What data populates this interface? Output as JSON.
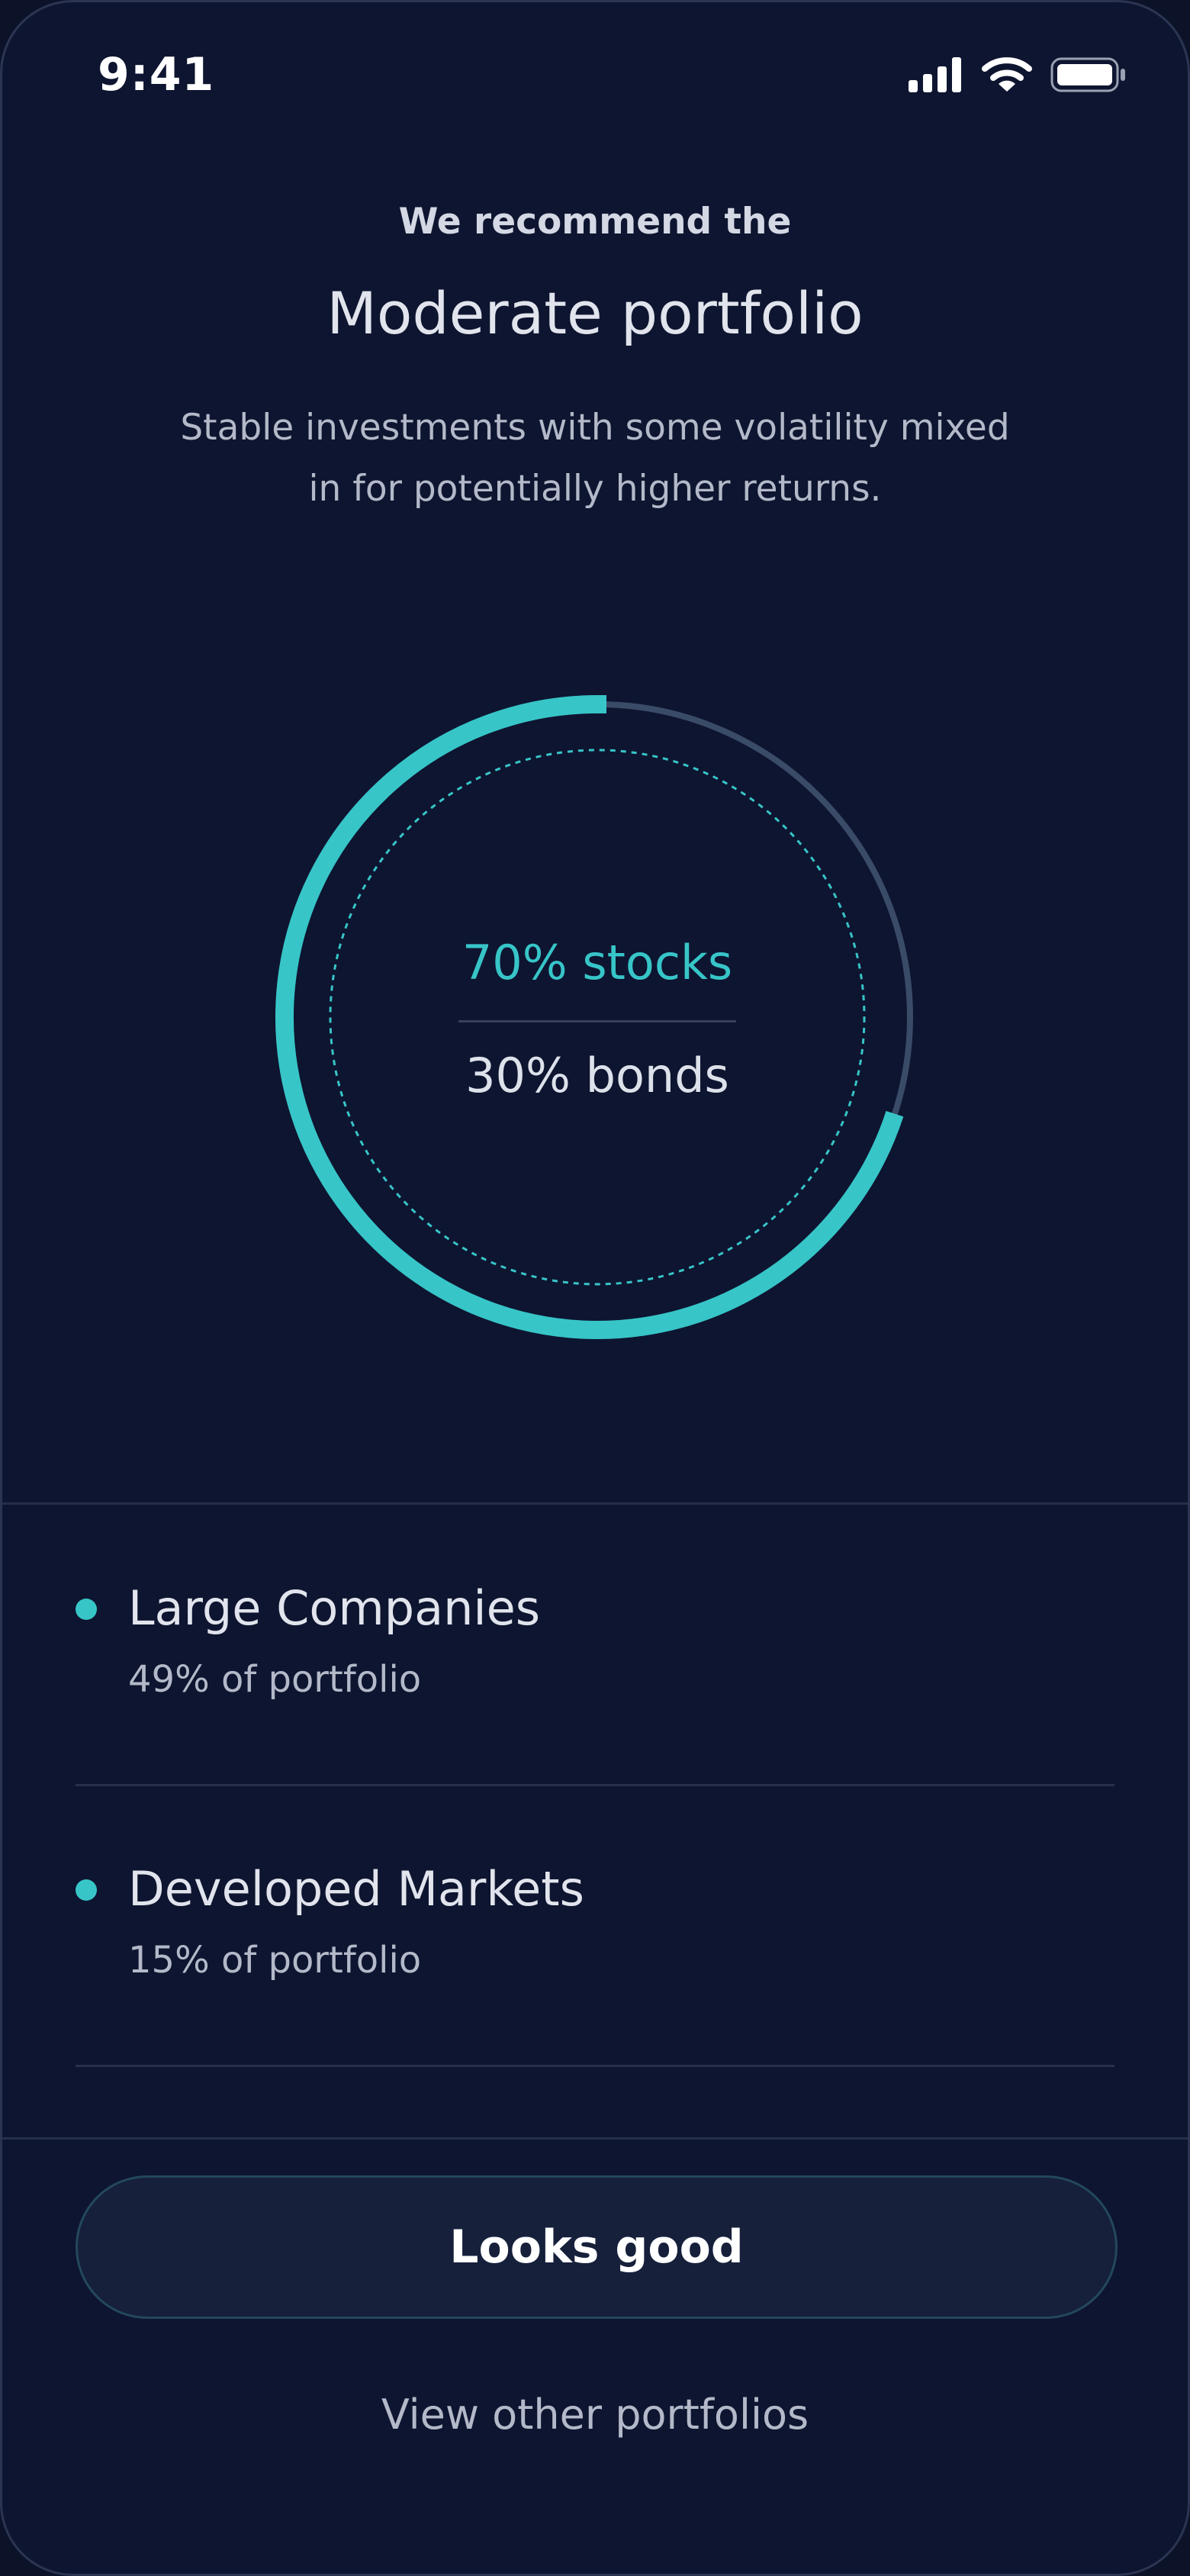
{
  "status_bar": {
    "time": "9:41",
    "icons": [
      "cellular-signal-icon",
      "wifi-icon",
      "battery-icon"
    ]
  },
  "header": {
    "eyebrow": "We recommend the",
    "title": "Moderate portfolio",
    "description": "Stable investments with some volatility mixed in for potentially higher returns."
  },
  "allocation": {
    "stocks_label": "70% stocks",
    "bonds_label": "30% bonds",
    "stocks_fraction": 0.7,
    "bonds_fraction": 0.3,
    "colors": {
      "stocks": "#37c5c8",
      "bonds": "#3a4b68"
    }
  },
  "holdings": [
    {
      "name": "Large Companies",
      "share": "49% of portfolio"
    },
    {
      "name": "Developed Markets",
      "share": "15% of portfolio"
    }
  ],
  "actions": {
    "primary_label": "Looks good",
    "secondary_label": "View other portfolios"
  },
  "colors": {
    "background": "#0e1530",
    "accent": "#37c5c8"
  }
}
